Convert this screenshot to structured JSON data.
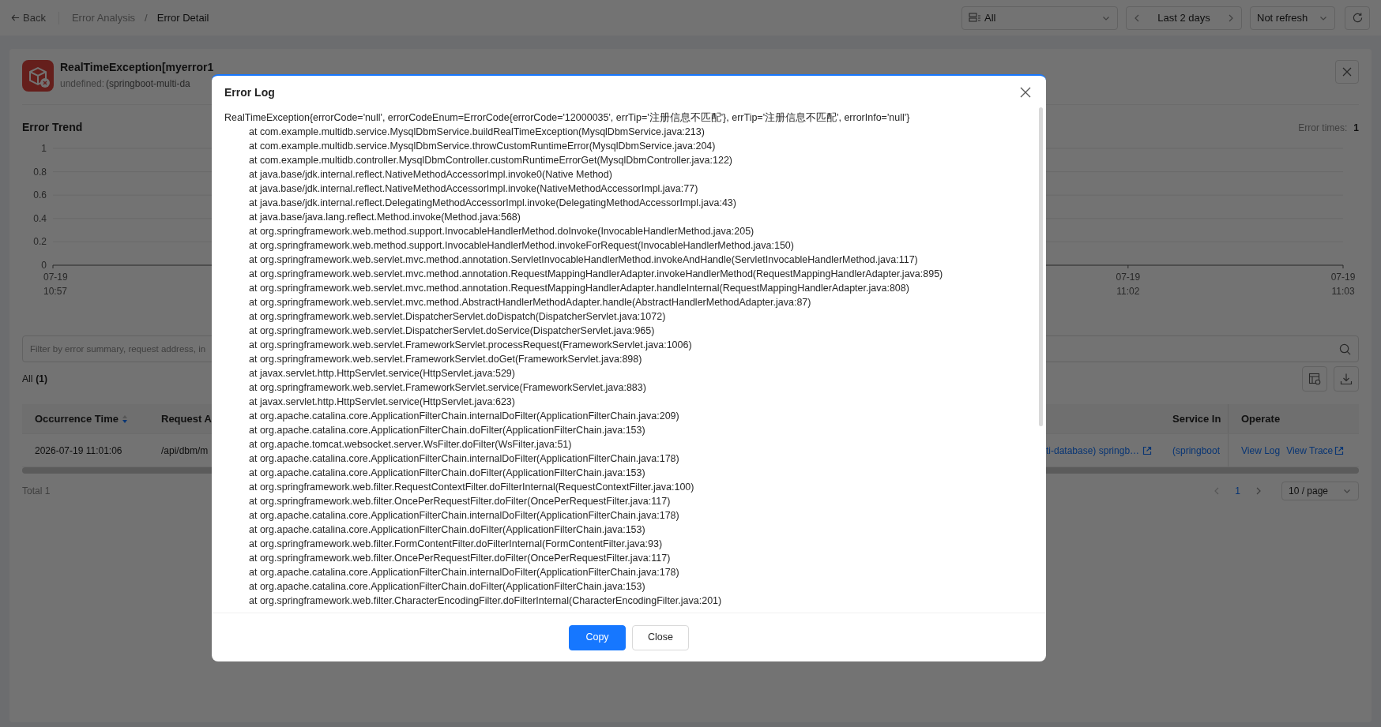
{
  "nav": {
    "back": "Back",
    "separator": "/",
    "breadcrumbs": [
      {
        "label": "Error Analysis",
        "selected": false
      },
      {
        "label": "Error Detail",
        "selected": true
      }
    ]
  },
  "toolbar": {
    "service_filter": "All",
    "time_range": "Last 2 days",
    "refresh": "Not refresh"
  },
  "header": {
    "title": "RealTimeException[myerror1",
    "subtitle_prefix": "undefined:",
    "subtitle": "(springboot-multi-da"
  },
  "trend": {
    "title": "Error Trend",
    "count_label": "Error times:",
    "count": "1",
    "y_axis_labels": [
      "1",
      "0.8",
      "0.6",
      "0.4",
      "0.2",
      "0"
    ],
    "x_axis_labels": [
      {
        "date": "07-19",
        "time": "10:57"
      },
      {
        "date": "07-19",
        "time": "11:02"
      },
      {
        "date": "07-19",
        "time": "11:03"
      }
    ]
  },
  "filter": {
    "placeholder": "Filter by error summary, request address, in"
  },
  "list": {
    "tab": "All",
    "count": "(1)",
    "columns": [
      "Occurrence Time",
      "Request A",
      "Service In",
      "Operate"
    ],
    "rows": [
      {
        "time": "2026-07-19 11:01:06",
        "request": "/api/dbm/m",
        "service_link": "ti-database) springb…",
        "service": "(springboot",
        "actions": [
          {
            "label": "View Log",
            "external": false
          },
          {
            "label": "View Trace",
            "external": true
          }
        ]
      }
    ],
    "total": "Total 1",
    "page": "1",
    "page_size": "10 / page"
  },
  "modal": {
    "title": "Error Log",
    "message": "RealTimeException{errorCode='null', errorCodeEnum=ErrorCode{errorCode='12000035', errTip='注册信息不匹配'}, errTip='注册信息不匹配', errorInfo='null'}",
    "frames": [
      "at com.example.multidb.service.MysqlDbmService.buildRealTimeException(MysqlDbmService.java:213)",
      "at com.example.multidb.service.MysqlDbmService.throwCustomRuntimeError(MysqlDbmService.java:204)",
      "at com.example.multidb.controller.MysqlDbmController.customRuntimeErrorGet(MysqlDbmController.java:122)",
      "at java.base/jdk.internal.reflect.NativeMethodAccessorImpl.invoke0(Native Method)",
      "at java.base/jdk.internal.reflect.NativeMethodAccessorImpl.invoke(NativeMethodAccessorImpl.java:77)",
      "at java.base/jdk.internal.reflect.DelegatingMethodAccessorImpl.invoke(DelegatingMethodAccessorImpl.java:43)",
      "at java.base/java.lang.reflect.Method.invoke(Method.java:568)",
      "at org.springframework.web.method.support.InvocableHandlerMethod.doInvoke(InvocableHandlerMethod.java:205)",
      "at org.springframework.web.method.support.InvocableHandlerMethod.invokeForRequest(InvocableHandlerMethod.java:150)",
      "at org.springframework.web.servlet.mvc.method.annotation.ServletInvocableHandlerMethod.invokeAndHandle(ServletInvocableHandlerMethod.java:117)",
      "at org.springframework.web.servlet.mvc.method.annotation.RequestMappingHandlerAdapter.invokeHandlerMethod(RequestMappingHandlerAdapter.java:895)",
      "at org.springframework.web.servlet.mvc.method.annotation.RequestMappingHandlerAdapter.handleInternal(RequestMappingHandlerAdapter.java:808)",
      "at org.springframework.web.servlet.mvc.method.AbstractHandlerMethodAdapter.handle(AbstractHandlerMethodAdapter.java:87)",
      "at org.springframework.web.servlet.DispatcherServlet.doDispatch(DispatcherServlet.java:1072)",
      "at org.springframework.web.servlet.DispatcherServlet.doService(DispatcherServlet.java:965)",
      "at org.springframework.web.servlet.FrameworkServlet.processRequest(FrameworkServlet.java:1006)",
      "at org.springframework.web.servlet.FrameworkServlet.doGet(FrameworkServlet.java:898)",
      "at javax.servlet.http.HttpServlet.service(HttpServlet.java:529)",
      "at org.springframework.web.servlet.FrameworkServlet.service(FrameworkServlet.java:883)",
      "at javax.servlet.http.HttpServlet.service(HttpServlet.java:623)",
      "at org.apache.catalina.core.ApplicationFilterChain.internalDoFilter(ApplicationFilterChain.java:209)",
      "at org.apache.catalina.core.ApplicationFilterChain.doFilter(ApplicationFilterChain.java:153)",
      "at org.apache.tomcat.websocket.server.WsFilter.doFilter(WsFilter.java:51)",
      "at org.apache.catalina.core.ApplicationFilterChain.internalDoFilter(ApplicationFilterChain.java:178)",
      "at org.apache.catalina.core.ApplicationFilterChain.doFilter(ApplicationFilterChain.java:153)",
      "at org.springframework.web.filter.RequestContextFilter.doFilterInternal(RequestContextFilter.java:100)",
      "at org.springframework.web.filter.OncePerRequestFilter.doFilter(OncePerRequestFilter.java:117)",
      "at org.apache.catalina.core.ApplicationFilterChain.internalDoFilter(ApplicationFilterChain.java:178)",
      "at org.apache.catalina.core.ApplicationFilterChain.doFilter(ApplicationFilterChain.java:153)",
      "at org.springframework.web.filter.FormContentFilter.doFilterInternal(FormContentFilter.java:93)",
      "at org.springframework.web.filter.OncePerRequestFilter.doFilter(OncePerRequestFilter.java:117)",
      "at org.apache.catalina.core.ApplicationFilterChain.internalDoFilter(ApplicationFilterChain.java:178)",
      "at org.apache.catalina.core.ApplicationFilterChain.doFilter(ApplicationFilterChain.java:153)",
      "at org.springframework.web.filter.CharacterEncodingFilter.doFilterInternal(CharacterEncodingFilter.java:201)"
    ],
    "buttons": [
      {
        "label": "Copy",
        "kind": "primary"
      },
      {
        "label": "Close",
        "kind": "default"
      }
    ]
  }
}
